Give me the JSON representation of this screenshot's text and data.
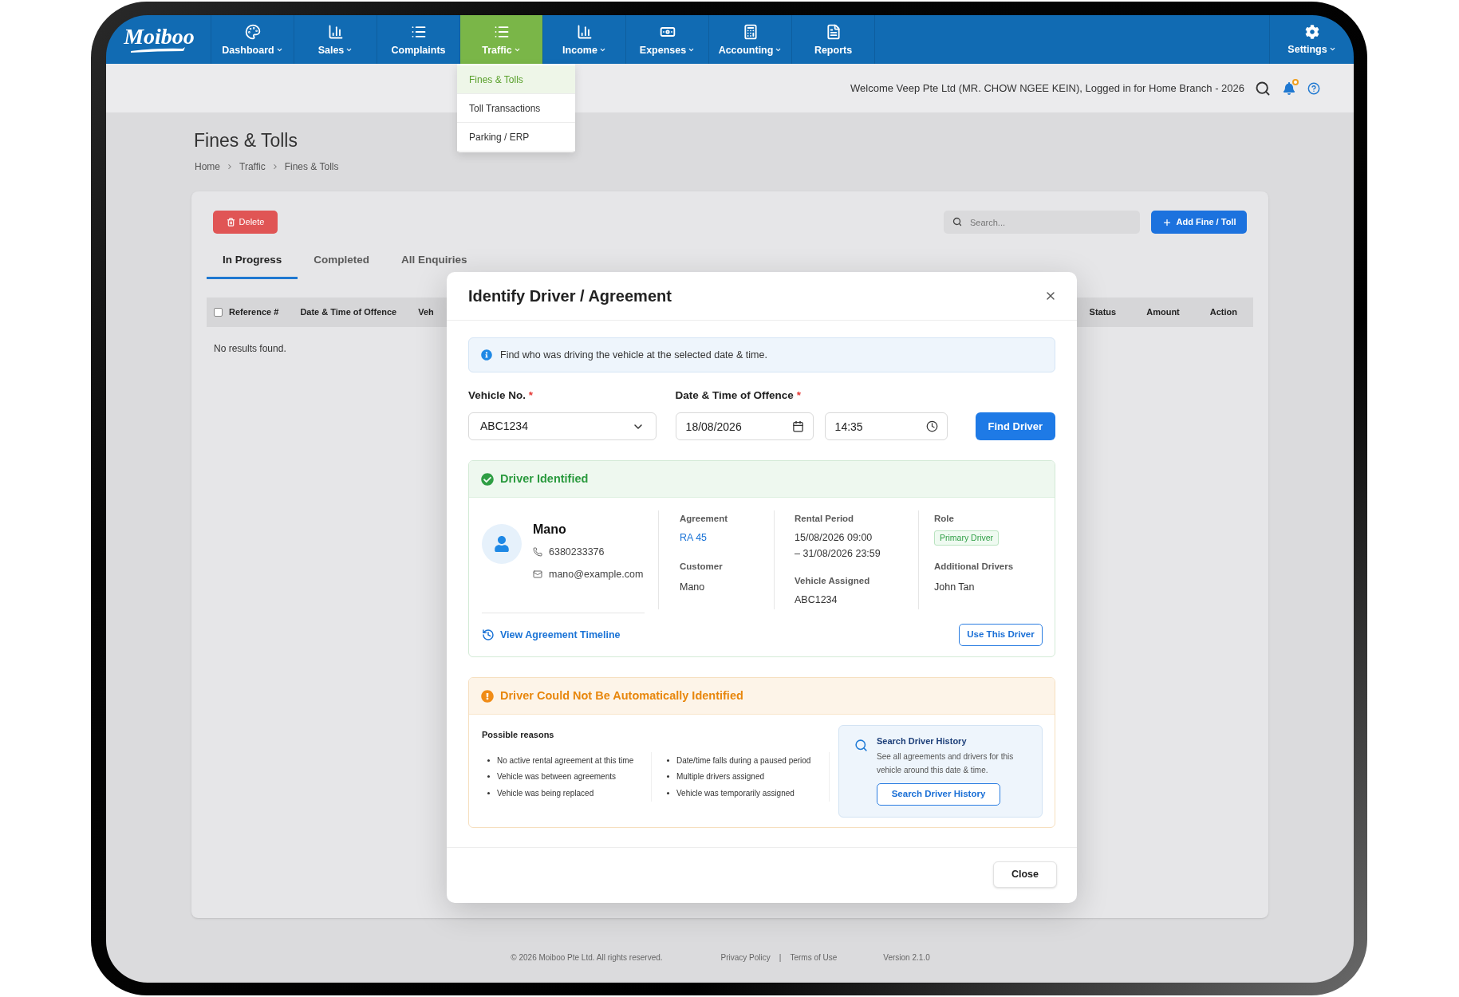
{
  "nav": {
    "logo": "Moiboo",
    "items": [
      {
        "label": "Dashboard",
        "has_menu": true,
        "selected": false
      },
      {
        "label": "Sales",
        "has_menu": true,
        "selected": false
      },
      {
        "label": "Complaints",
        "has_menu": false,
        "selected": false
      },
      {
        "label": "Traffic",
        "has_menu": true,
        "selected": true
      },
      {
        "label": "Income",
        "has_menu": true,
        "selected": false
      },
      {
        "label": "Expenses",
        "has_menu": true,
        "selected": false
      },
      {
        "label": "Accounting",
        "has_menu": true,
        "selected": false
      },
      {
        "label": "Reports",
        "has_menu": false,
        "selected": false
      }
    ],
    "settings": {
      "label": "Settings",
      "has_menu": true
    }
  },
  "traffic_menu": [
    {
      "label": "Fines & Tolls",
      "selected": true
    },
    {
      "label": "Toll Transactions",
      "selected": false
    },
    {
      "label": "Parking / ERP",
      "selected": false
    }
  ],
  "header": {
    "welcome": "Welcome Veep Pte Ltd (MR. CHOW NGEE KEIN), Logged in for Home Branch - 2026",
    "has_notification": true
  },
  "page": {
    "title": "Fines & Tolls",
    "breadcrumb": [
      "Home",
      "Traffic",
      "Fines & Tolls"
    ]
  },
  "toolbar": {
    "delete_button": "Delete",
    "search_placeholder": "Search...",
    "add_button": "Add Fine / Toll"
  },
  "tabs": [
    {
      "label": "In Progress",
      "selected": true
    },
    {
      "label": "Completed",
      "selected": false
    },
    {
      "label": "All Enquiries",
      "selected": false
    }
  ],
  "table": {
    "select_all_checked": false,
    "columns_left": [
      "Reference #",
      "Date & Time of Offence",
      "Veh"
    ],
    "columns_right": [
      "Status",
      "Amount",
      "Action"
    ],
    "empty_text": "No results found."
  },
  "modal": {
    "title": "Identify Driver / Agreement",
    "info": "Find who was driving the vehicle at the selected date & time.",
    "vehicle": {
      "label": "Vehicle No.",
      "required_mark": "*",
      "value": "ABC1234"
    },
    "offence_time": {
      "label": "Date & Time of Offence",
      "required_mark": "*",
      "date": "18/08/2026",
      "time": "14:35"
    },
    "find_button": "Find Driver",
    "driver_identified": {
      "title": "Driver Identified",
      "name": "Mano",
      "phone": "6380233376",
      "email": "mano@example.com",
      "agreement": {
        "label": "Agreement",
        "value": "RA 45"
      },
      "customer": {
        "label": "Customer",
        "value": "Mano"
      },
      "rental_period": {
        "label": "Rental Period",
        "lines": [
          "15/08/2026 09:00",
          "– 31/08/2026 23:59"
        ]
      },
      "vehicle_assigned": {
        "label": "Vehicle Assigned",
        "value": "ABC1234"
      },
      "role": {
        "label": "Role",
        "tag": "Primary Driver"
      },
      "additional_drivers": {
        "label": "Additional Drivers",
        "value": "John Tan"
      },
      "timeline_link": "View Agreement Timeline",
      "use_button": "Use This Driver"
    },
    "not_identified": {
      "title": "Driver Could Not Be Automatically Identified",
      "reasons_heading": "Possible reasons",
      "reason_columns": [
        {
          "items": [
            "No active rental agreement at this time",
            "Vehicle was between agreements",
            "Vehicle was being replaced"
          ]
        },
        {
          "items": [
            "Date/time falls during a paused period",
            "Multiple drivers assigned",
            "Vehicle was temporarily assigned"
          ]
        }
      ],
      "history": {
        "title": "Search Driver History",
        "description": "See all agreements and drivers for this vehicle around this date & time.",
        "button": "Search Driver History"
      }
    },
    "close_button": "Close"
  },
  "footer": {
    "copyright": "© 2026 Moiboo Pte Ltd. All rights reserved.",
    "links": [
      "Privacy Policy",
      "Terms of Use"
    ],
    "separator": "|",
    "version": "Version 2.1.0"
  }
}
